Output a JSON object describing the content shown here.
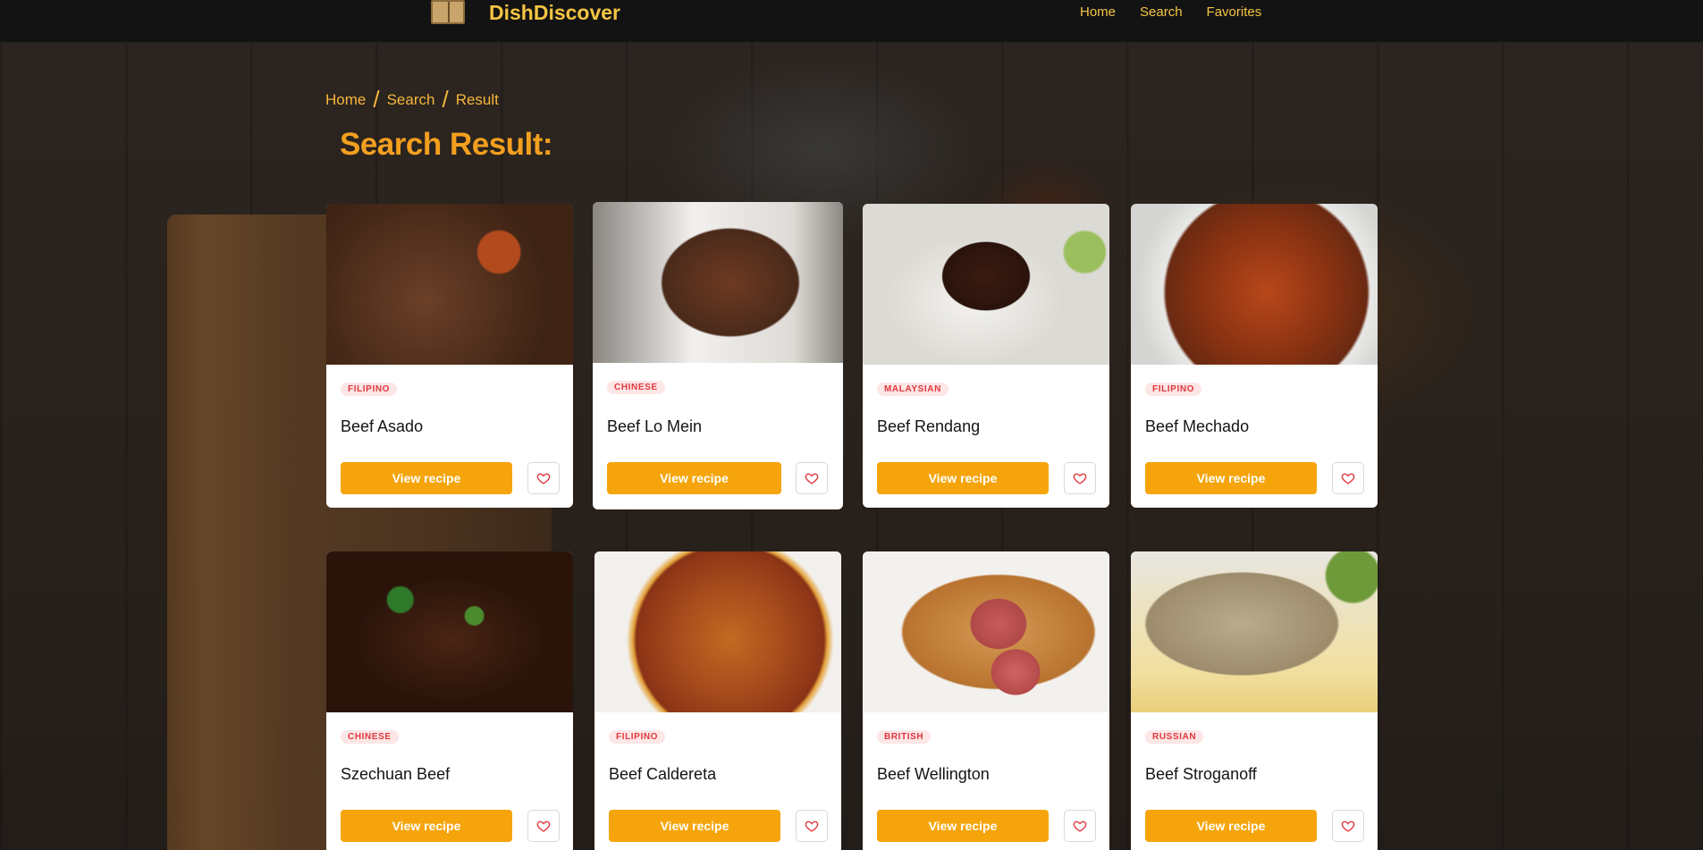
{
  "app": {
    "name": "DishDiscover",
    "logo_icon": "book-icon"
  },
  "nav": [
    {
      "label": "Home"
    },
    {
      "label": "Search"
    },
    {
      "label": "Favorites"
    }
  ],
  "breadcrumb": [
    "Home",
    "Search",
    "Result"
  ],
  "page_title": "Search Result:",
  "colors": {
    "accent": "#f5a50b",
    "brand": "#f5c542",
    "badge_text": "#e0383e",
    "badge_bg": "#fde6e6"
  },
  "cards": [
    {
      "cuisine": "FILIPINO",
      "title": "Beef Asado",
      "button": "View recipe",
      "fav_icon": "heart-icon"
    },
    {
      "cuisine": "CHINESE",
      "title": "Beef Lo Mein",
      "button": "View recipe",
      "fav_icon": "heart-icon"
    },
    {
      "cuisine": "MALAYSIAN",
      "title": "Beef Rendang",
      "button": "View recipe",
      "fav_icon": "heart-icon"
    },
    {
      "cuisine": "FILIPINO",
      "title": "Beef Mechado",
      "button": "View recipe",
      "fav_icon": "heart-icon"
    },
    {
      "cuisine": "CHINESE",
      "title": "Szechuan Beef",
      "button": "View recipe",
      "fav_icon": "heart-icon"
    },
    {
      "cuisine": "FILIPINO",
      "title": "Beef Caldereta",
      "button": "View recipe",
      "fav_icon": "heart-icon"
    },
    {
      "cuisine": "BRITISH",
      "title": "Beef Wellington",
      "button": "View recipe",
      "fav_icon": "heart-icon"
    },
    {
      "cuisine": "RUSSIAN",
      "title": "Beef Stroganoff",
      "button": "View recipe",
      "fav_icon": "heart-icon"
    }
  ]
}
